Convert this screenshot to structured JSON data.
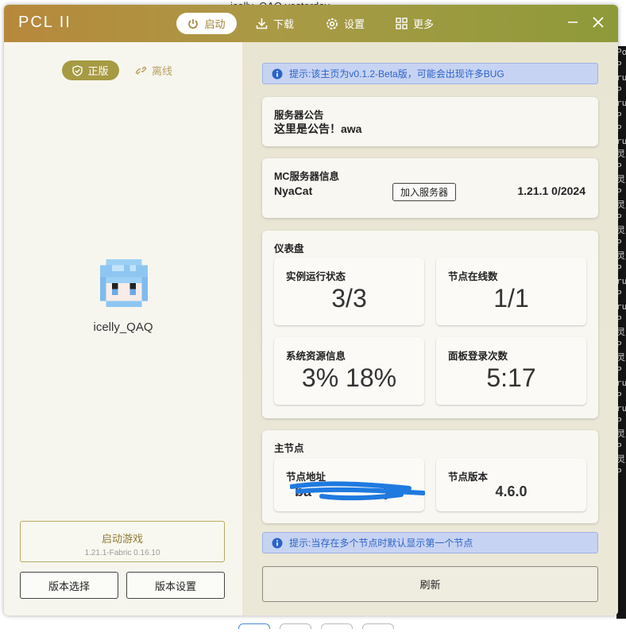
{
  "background": {
    "top_text": "icelly_QAQ  yesterday",
    "right_text": "Po P ru P ru P P ru 灵 P 灵 P 灵 P 灵 P 灵 P ru P ru P 灵 P 灵 P ru P ru P 灵 P 灵 P"
  },
  "titlebar": {
    "app_title": "PCL II",
    "nav": {
      "launch": "启动",
      "download": "下载",
      "settings": "设置",
      "more": "更多"
    }
  },
  "left": {
    "official_label": "正版",
    "offline_label": "离线",
    "username": "icelly_QAQ",
    "launch_button": {
      "title": "启动游戏",
      "subtitle": "1.21.1-Fabric 0.16.10"
    },
    "version_select": "版本选择",
    "version_settings": "版本设置"
  },
  "right": {
    "tip_top": "提示:该主页为v0.1.2-Beta版，可能会出现许多BUG",
    "notice": {
      "title": "服务器公告",
      "text": "这里是公告！awa"
    },
    "server": {
      "title": "MC服务器信息",
      "name": "NyaCat",
      "join_button": "加入服务器",
      "status": "1.21.1  0/2024"
    },
    "dashboard": {
      "title": "仪表盘",
      "instance_label": "实例运行状态",
      "instance_value": "3/3",
      "nodes_label": "节点在线数",
      "nodes_value": "1/1",
      "resources_label": "系统资源信息",
      "resources_value": "3%  18%",
      "logins_label": "面板登录次数",
      "logins_value": "5:17"
    },
    "main_node": {
      "title": "主节点",
      "address_label": "节点地址",
      "address_value": "ba",
      "address_value_tail": "yz",
      "version_label": "节点版本",
      "version_value": "4.6.0"
    },
    "tip_bottom": "提示:当存在多个节点时默认显示第一个节点",
    "refresh_button": "刷新"
  },
  "colors": {
    "accent_gold": "#a69a43",
    "titlebar_start": "#b7883c",
    "titlebar_end": "#8e9a3a",
    "tip_background": "#c7d3f2",
    "tip_text": "#2c63c9",
    "redaction_blue": "#1f7ae0"
  }
}
